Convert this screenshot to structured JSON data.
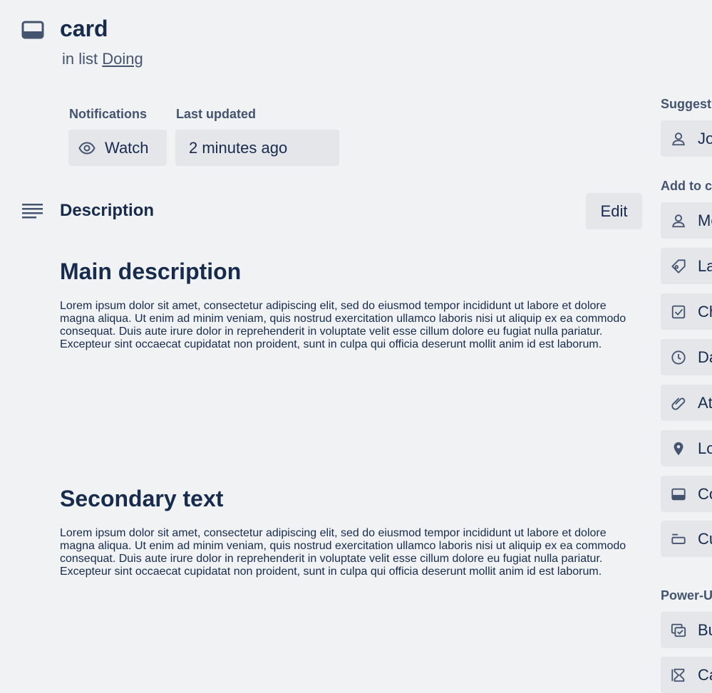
{
  "card": {
    "title": "card",
    "in_list_prefix": "in list",
    "list_name": "Doing"
  },
  "meta": {
    "notifications_label": "Notifications",
    "watch_label": "Watch",
    "last_updated_label": "Last updated",
    "last_updated_value": "2 minutes ago"
  },
  "description": {
    "heading": "Description",
    "edit_label": "Edit",
    "sections": [
      {
        "title": "Main description",
        "body": "Lorem ipsum dolor sit amet, consectetur adipiscing elit, sed do eiusmod tempor incididunt ut labore et dolore magna aliqua. Ut enim ad minim veniam, quis nostrud exercitation ullamco laboris nisi ut aliquip ex ea commodo consequat. Duis aute irure dolor in reprehenderit in voluptate velit esse cillum dolore eu fugiat nulla pariatur. Excepteur sint occaecat cupidatat non proident, sunt in culpa qui officia deserunt mollit anim id est laborum."
      },
      {
        "title": "Secondary text",
        "body": "Lorem ipsum dolor sit amet, consectetur adipiscing elit, sed do eiusmod tempor incididunt ut labore et dolore magna aliqua. Ut enim ad minim veniam, quis nostrud exercitation ullamco laboris nisi ut aliquip ex ea commodo consequat. Duis aute irure dolor in reprehenderit in voluptate velit esse cillum dolore eu fugiat nulla pariatur. Excepteur sint occaecat cupidatat non proident, sunt in culpa qui officia deserunt mollit anim id est laborum."
      }
    ]
  },
  "sidebar": {
    "suggested_label": "Suggest",
    "suggested_items": [
      {
        "label": "Jo",
        "icon": "person-icon"
      }
    ],
    "add_to_card_label": "Add to c",
    "add_items": [
      {
        "label": "Me",
        "icon": "person-icon"
      },
      {
        "label": "La",
        "icon": "tag-icon"
      },
      {
        "label": "Ch",
        "icon": "checkbox-icon"
      },
      {
        "label": "Da",
        "icon": "clock-icon"
      },
      {
        "label": "At",
        "icon": "paperclip-icon"
      },
      {
        "label": "Lo",
        "icon": "location-pin-icon"
      },
      {
        "label": "Co",
        "icon": "card-cover-icon"
      },
      {
        "label": "Cu",
        "icon": "custom-fields-icon"
      }
    ],
    "powerups_label": "Power-U",
    "powerup_items": [
      {
        "label": "Bu",
        "icon": "butler-icon"
      },
      {
        "label": "Ca",
        "icon": "hourglass-icon"
      }
    ]
  },
  "colors": {
    "background": "#f1f2f4",
    "button_bg": "#e4e6ea",
    "text_primary": "#172b4d",
    "text_secondary": "#44546f"
  }
}
